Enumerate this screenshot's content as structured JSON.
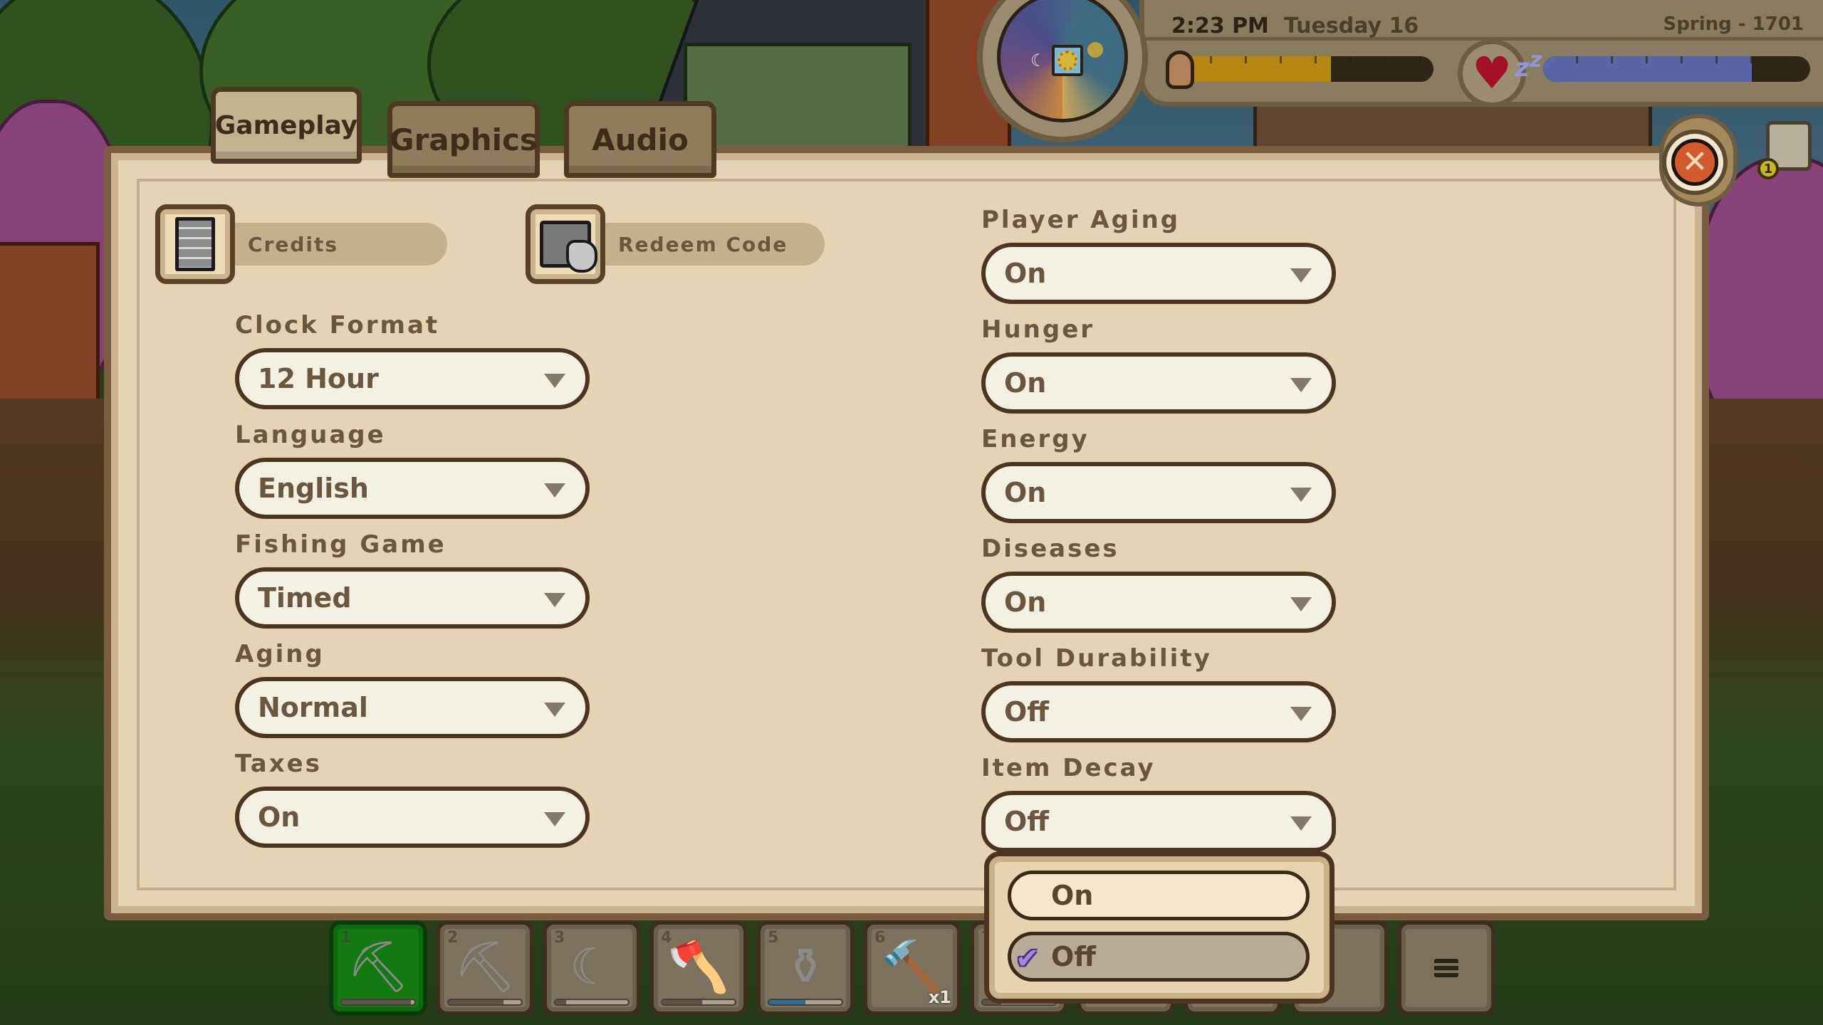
{
  "hud": {
    "time": "2:23 PM",
    "date": "Tuesday 16",
    "season_year": "Spring - 1701",
    "hunger_fraction": 0.6,
    "energy_fraction": 0.78,
    "icons": {
      "clock": "day-night-clock-icon",
      "season": "sun-flower-icon",
      "hunger": "bread-icon",
      "health": "heart-icon",
      "energy": "zzz-sleep-icon",
      "quest": "scroll-icon"
    },
    "quest_badge_count": "1",
    "colors": {
      "hunger_bar": "#b7860e",
      "energy_bar": "#5a65a8",
      "health": "#a3102a"
    }
  },
  "settings": {
    "tabs": [
      {
        "label": "Gameplay",
        "active": true
      },
      {
        "label": "Graphics",
        "active": false
      },
      {
        "label": "Audio",
        "active": false
      }
    ],
    "close_label": "✕",
    "links": {
      "credits": {
        "label": "Credits",
        "icon": "document-icon"
      },
      "redeem": {
        "label": "Redeem Code",
        "icon": "redeem-hand-icon"
      }
    },
    "left_fields": [
      {
        "label": "Clock Format",
        "value": "12 Hour"
      },
      {
        "label": "Language",
        "value": "English"
      },
      {
        "label": "Fishing Game",
        "value": "Timed"
      },
      {
        "label": "Aging",
        "value": "Normal"
      },
      {
        "label": "Taxes",
        "value": "On"
      }
    ],
    "right_fields": [
      {
        "label": "Player Aging",
        "value": "On"
      },
      {
        "label": "Hunger",
        "value": "On"
      },
      {
        "label": "Energy",
        "value": "On"
      },
      {
        "label": "Diseases",
        "value": "On"
      },
      {
        "label": "Tool Durability",
        "value": "Off"
      },
      {
        "label": "Item Decay",
        "value": "Off"
      }
    ],
    "open_dropdown": {
      "field": "Item Decay",
      "options": [
        {
          "label": "On",
          "selected": false
        },
        {
          "label": "Off",
          "selected": true
        }
      ]
    },
    "colors": {
      "panel_bg": "#e4d3b4",
      "panel_border": "#7a5c3e",
      "label_text": "#6b5640",
      "checkmark": "#a48ad6"
    }
  },
  "hotbar": {
    "slots": [
      {
        "number": "1",
        "item": "hoe-icon",
        "glyph": "⛏",
        "durability": 0.95,
        "selected": true
      },
      {
        "number": "2",
        "item": "pickaxe-icon",
        "glyph": "⛏",
        "durability": 0.75,
        "selected": false
      },
      {
        "number": "3",
        "item": "scythe-icon",
        "glyph": "☾",
        "durability": 0.15,
        "selected": false
      },
      {
        "number": "4",
        "item": "axe-icon",
        "glyph": "🪓",
        "durability": 0.55,
        "selected": false
      },
      {
        "number": "5",
        "item": "watering-can-icon",
        "glyph": "⚱",
        "durability": 0.5,
        "water": true,
        "selected": false
      },
      {
        "number": "6",
        "item": "hammer-icon",
        "glyph": "🔨",
        "quantity": "x1",
        "selected": false
      },
      {
        "number": "7",
        "item": "tool-icon",
        "glyph": "",
        "durability": 0.25,
        "selected": false
      }
    ],
    "menu_icon": "hamburger-menu-icon"
  }
}
